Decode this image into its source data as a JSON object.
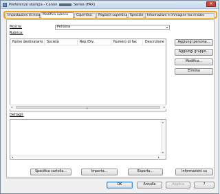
{
  "window": {
    "title_prefix": "Preferenze stampa - Canon",
    "title_suffix": "Series (FAX)",
    "close_glyph": "✕"
  },
  "tabs": [
    {
      "label": "Impostazioni di invio",
      "active": false
    },
    {
      "label": "Modifica rubrica",
      "active": true
    },
    {
      "label": "Copertina",
      "active": false
    },
    {
      "label": "Registra copertina",
      "active": false
    },
    {
      "label": "Speciale",
      "active": false
    },
    {
      "label": "Informazioni e immagine fax inviato",
      "active": false
    }
  ],
  "main": {
    "mostra_label": "Mostra:",
    "mostra_value": "Persona",
    "rubrica_label": "Rubrica:",
    "columns": [
      "Nome destinatario",
      "Società",
      "Rep./Div.",
      "Numero di fax",
      "Descrizione"
    ],
    "dettagli_label": "Dettagli:"
  },
  "side_buttons": {
    "add_person": "Aggiungi persona...",
    "add_group": "Aggiungi gruppo...",
    "edit": "Modifica...",
    "delete": "Elimina"
  },
  "bottom_buttons": {
    "specify_folder": "Specifica cartella...",
    "import": "Importa...",
    "export": "Esporta...",
    "info": "Informazioni su"
  },
  "footer_buttons": {
    "ok": "OK",
    "cancel": "Annulla",
    "apply": "Applica",
    "help": "?"
  },
  "icons": {
    "dropdown": "▾",
    "left": "◂",
    "right": "▸",
    "up": "▴",
    "down": "▾",
    "grip": "|||"
  }
}
